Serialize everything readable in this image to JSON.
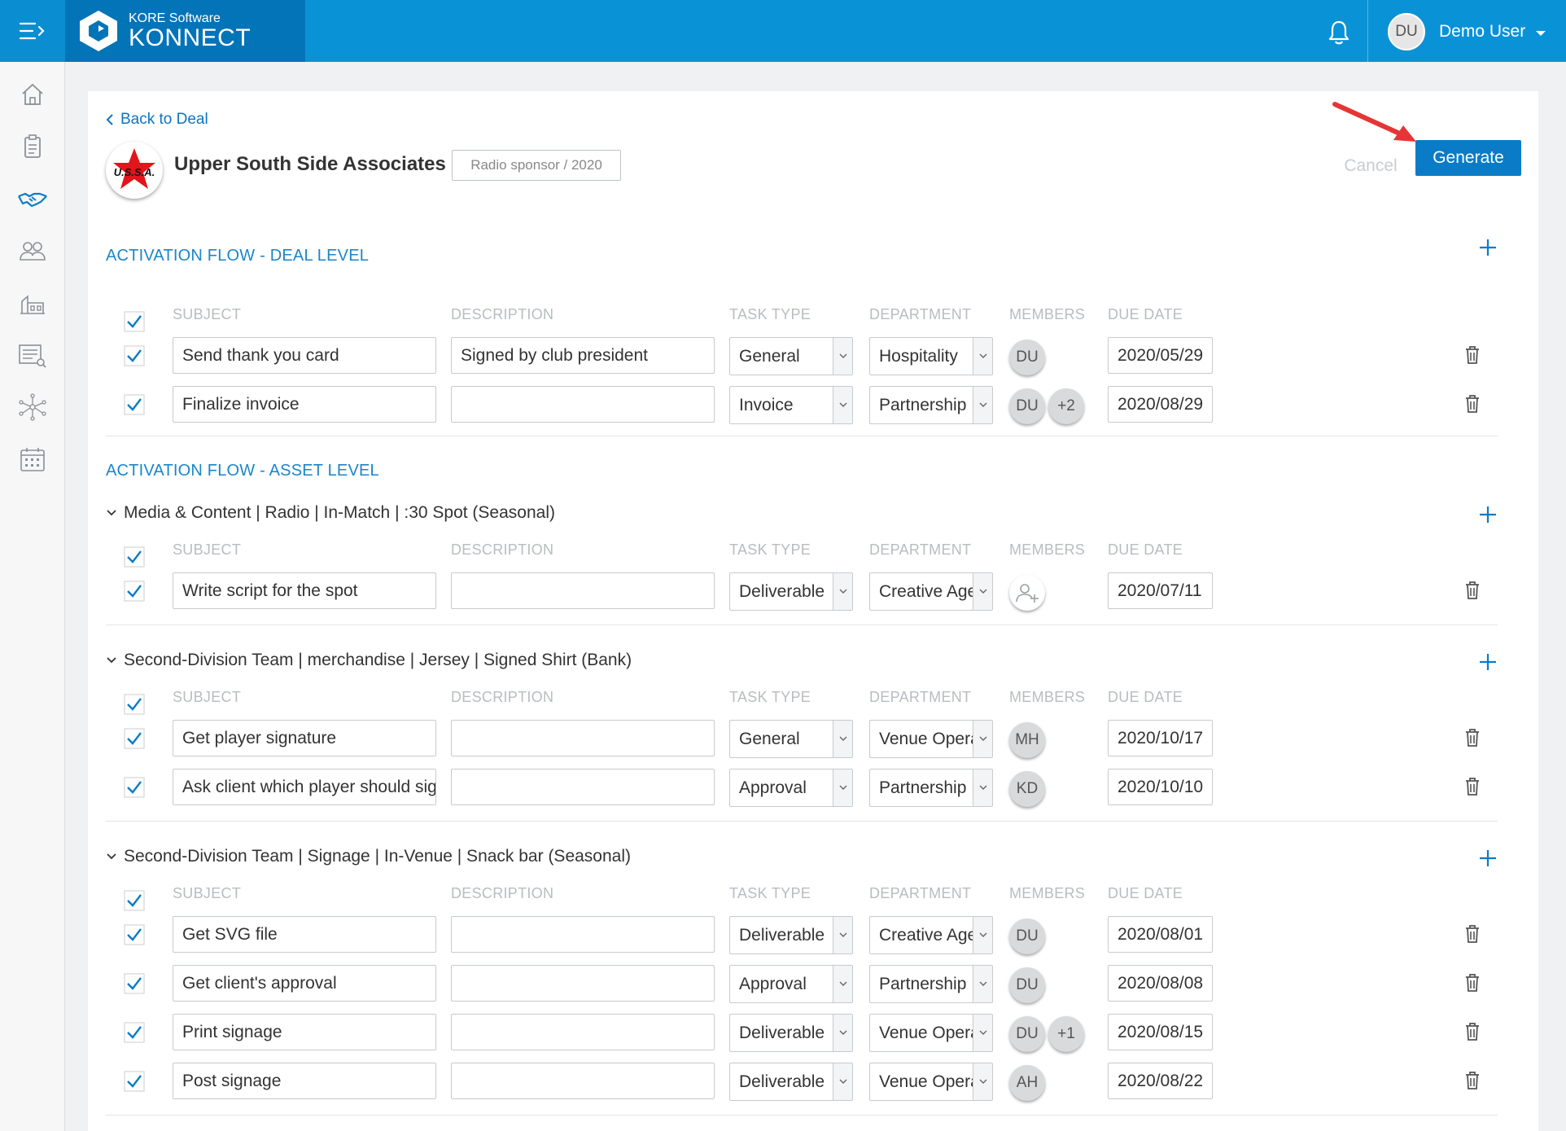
{
  "header": {
    "brand_sub": "KORE Software",
    "brand_main": "KONNECT",
    "user_initials": "DU",
    "user_name": "Demo User"
  },
  "page": {
    "back_label": "Back to Deal",
    "client_name": "Upper South Side Associates",
    "client_logo_text": "U.S.S.A.",
    "deal_tag": "Radio sponsor / 2020",
    "cancel_label": "Cancel",
    "generate_label": "Generate"
  },
  "columns": {
    "subject": "SUBJECT",
    "description": "DESCRIPTION",
    "task_type": "TASK TYPE",
    "department": "DEPARTMENT",
    "members": "MEMBERS",
    "due_date": "DUE DATE"
  },
  "deal_section": {
    "title": "ACTIVATION FLOW - DEAL LEVEL",
    "tasks": [
      {
        "subject": "Send thank you card",
        "description": "Signed by club president",
        "task_type": "General",
        "department": "Hospitality",
        "members": [
          "DU"
        ],
        "due": "2020/05/29"
      },
      {
        "subject": "Finalize invoice",
        "description": "",
        "task_type": "Invoice",
        "department": "Partnership Management",
        "members": [
          "DU",
          "+2"
        ],
        "due": "2020/08/29"
      }
    ]
  },
  "asset_section": {
    "title": "ACTIVATION FLOW - ASSET LEVEL",
    "groups": [
      {
        "title": "Media & Content | Radio | In-Match | :30 Spot (Seasonal)",
        "tasks": [
          {
            "subject": "Write script for the spot",
            "description": "",
            "task_type": "Deliverable",
            "department": "Creative Agency",
            "members": [],
            "due": "2020/07/11"
          }
        ]
      },
      {
        "title": "Second-Division Team | merchandise | Jersey | Signed Shirt (Bank)",
        "tasks": [
          {
            "subject": "Get player signature",
            "description": "",
            "task_type": "General",
            "department": "Venue Operations",
            "members": [
              "MH"
            ],
            "due": "2020/10/17"
          },
          {
            "subject": "Ask client which player should sign",
            "description": "",
            "task_type": "Approval",
            "department": "Partnership Management",
            "members": [
              "KD"
            ],
            "due": "2020/10/10"
          }
        ]
      },
      {
        "title": "Second-Division Team | Signage | In-Venue | Snack bar (Seasonal)",
        "tasks": [
          {
            "subject": "Get SVG file",
            "description": "",
            "task_type": "Deliverable",
            "department": "Creative Agency",
            "members": [
              "DU"
            ],
            "due": "2020/08/01"
          },
          {
            "subject": "Get client's approval",
            "description": "",
            "task_type": "Approval",
            "department": "Partnership Management",
            "members": [
              "DU"
            ],
            "due": "2020/08/08"
          },
          {
            "subject": "Print signage",
            "description": "",
            "task_type": "Deliverable",
            "department": "Venue Operations",
            "members": [
              "DU",
              "+1"
            ],
            "due": "2020/08/15"
          },
          {
            "subject": "Post signage",
            "description": "",
            "task_type": "Deliverable",
            "department": "Venue Operations",
            "members": [
              "AH"
            ],
            "due": "2020/08/22"
          }
        ]
      }
    ]
  },
  "colors": {
    "topbar": "#0a92d6",
    "brand_block": "#0474b8",
    "accent": "#0a7cc7",
    "section_title": "#1a86c9",
    "arrow": "#e63535"
  }
}
